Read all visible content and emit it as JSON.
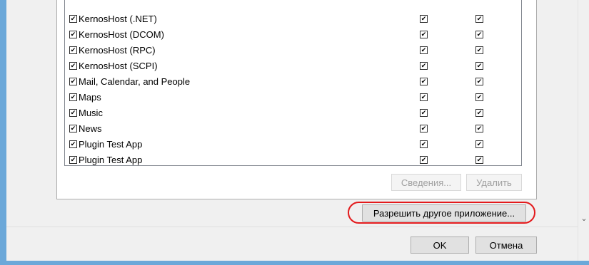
{
  "apps_list": {
    "items": [
      {
        "label": "KernosHost (.NET)",
        "c1": "☑",
        "c2": "☑"
      },
      {
        "label": "KernosHost (DCOM)",
        "c1": "☑",
        "c2": "☑"
      },
      {
        "label": "KernosHost (RPC)",
        "c1": "☑",
        "c2": "☑"
      },
      {
        "label": "KernosHost (SCPI)",
        "c1": "☑",
        "c2": "☑"
      },
      {
        "label": "Mail, Calendar, and People",
        "c1": "☑",
        "c2": "☑"
      },
      {
        "label": "Maps",
        "c1": "☑",
        "c2": "☑"
      },
      {
        "label": "Music",
        "c1": "☑",
        "c2": "☑"
      },
      {
        "label": "News",
        "c1": "☑",
        "c2": "☑"
      },
      {
        "label": "Plugin Test App",
        "c1": "☑",
        "c2": "☑"
      },
      {
        "label": "Plugin Test App",
        "c1": "☑",
        "c2": "☑"
      }
    ],
    "scroll_down_icon": "chevron-down-icon"
  },
  "buttons": {
    "details": "Сведения...",
    "remove": "Удалить",
    "allow_another": "Разрешить другое приложение...",
    "ok": "OK",
    "cancel": "Отмена"
  },
  "colors": {
    "highlight": "#e31a1c",
    "frame": "#6ba8d9"
  }
}
